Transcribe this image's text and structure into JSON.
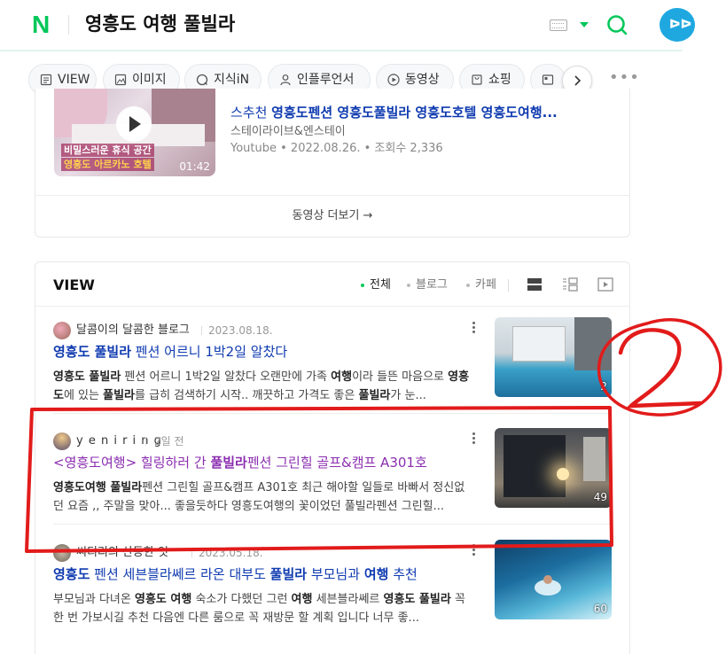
{
  "header": {
    "logo": "N",
    "query": "영흥도 여행 풀빌라",
    "avatar_text": "ሆ"
  },
  "tabs": [
    {
      "label": "VIEW"
    },
    {
      "label": "이미지"
    },
    {
      "label": "지식iN"
    },
    {
      "label": "인플루언서"
    },
    {
      "label": "동영상"
    },
    {
      "label": "쇼핑"
    }
  ],
  "video": {
    "title_prefix": "스추천 ",
    "title_highlight": "영흥도펜션 영흥도풀빌라 영흥도호텔 영흥도여행...",
    "channel": "스테이라이브&엔스테이",
    "meta": "Youtube • 2022.08.26. • 조회수 2,336",
    "thumb_caption1": "비밀스러운 휴식 공간",
    "thumb_caption2": "영흥도 아르카노 호텔",
    "duration": "01:42",
    "more_label": "동영상 더보기 →"
  },
  "view": {
    "title": "VIEW",
    "filters": [
      {
        "label": "전체",
        "active": true
      },
      {
        "label": "블로그",
        "active": false
      },
      {
        "label": "카페",
        "active": false
      }
    ],
    "posts": [
      {
        "author": "달콤이의 달콤한 블로그",
        "date": "2023.08.18.",
        "title_b1": "영흥도 풀빌라",
        "title_rest": " 펜션 어르니 1박2일 알찼다",
        "snippet_html_parts": [
          {
            "b": "영흥도 풀빌라"
          },
          {
            "t": " 펜션 어르니 1박2일 알찼다 오랜만에 가족 "
          },
          {
            "b": "여행"
          },
          {
            "t": "이라 들뜬 마음으로 "
          },
          {
            "b": "영흥도"
          },
          {
            "t": "에 있는 "
          },
          {
            "b": "풀빌라"
          },
          {
            "t": "를 급히 검색하기 시작.. 깨끗하고 가격도 좋은 "
          },
          {
            "b": "풀빌라"
          },
          {
            "t": "가 눈..."
          }
        ],
        "count": "2"
      },
      {
        "author": "y e n i r i n g",
        "date": "2일 전",
        "title_pre": "<영흥도여행> 힐링하러 간 ",
        "title_b": "풀빌라",
        "title_rest": "펜션 그린힐 골프&캠프 A301호",
        "snippet_html_parts": [
          {
            "b": "영흥도여행 풀빌라"
          },
          {
            "t": "펜션 그린힐 골프&캠프 A301호 최근 해야할 일들로 바빠서 정신없던 요즘 ,, 주말을 맞아... 좋을듯하다 영흥도여행의 꽃이었던 풀빌라펜션 그린힐..."
          }
        ],
        "count": "49"
      },
      {
        "author": "씨티리의 산동한 잇",
        "date": "2023.05.18.",
        "title_b1": "영흥도",
        "title_mid": " 펜션 세븐블라쎄르 라온 대부도 ",
        "title_b2": "풀빌라",
        "title_mid2": " 부모님과 ",
        "title_b3": "여행",
        "title_rest": " 추천",
        "snippet_html_parts": [
          {
            "t": "부모님과 다녀온 "
          },
          {
            "b": "영흥도 여행"
          },
          {
            "t": " 숙소가 다했던 그런 "
          },
          {
            "b": "여행"
          },
          {
            "t": " 세븐블라쎄르 "
          },
          {
            "b": "영흥도 풀빌라"
          },
          {
            "t": " 꼭 한 번 가보시길 추천 다음엔 다른 룸으로 꼭 재방문 할 계획 입니다 너무 좋..."
          }
        ],
        "count": "60"
      }
    ]
  },
  "annotation": {
    "label": "2",
    "color": "#e21b1b"
  }
}
